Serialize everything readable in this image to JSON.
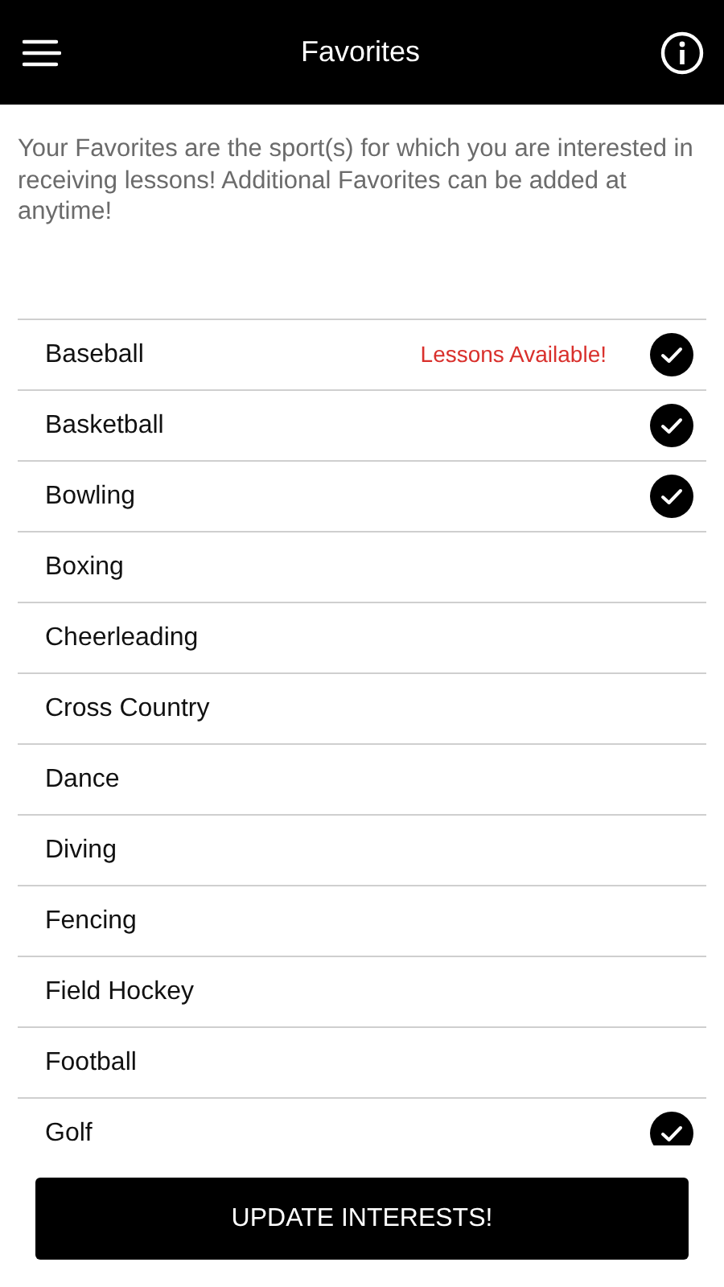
{
  "header": {
    "title": "Favorites"
  },
  "intro": "Your Favorites are the sport(s) for which you are interested in receiving lessons! Additional Favorites can be added at anytime!",
  "sports": [
    {
      "name": "Baseball",
      "note": "Lessons Available!",
      "checked": true
    },
    {
      "name": "Basketball",
      "checked": true
    },
    {
      "name": "Bowling",
      "checked": true
    },
    {
      "name": "Boxing",
      "checked": false
    },
    {
      "name": "Cheerleading",
      "checked": false
    },
    {
      "name": "Cross Country",
      "checked": false
    },
    {
      "name": "Dance",
      "checked": false
    },
    {
      "name": "Diving",
      "checked": false
    },
    {
      "name": "Fencing",
      "checked": false
    },
    {
      "name": "Field Hockey",
      "checked": false
    },
    {
      "name": "Football",
      "checked": false
    },
    {
      "name": "Golf",
      "checked": true
    }
  ],
  "button": "UPDATE INTERESTS!"
}
